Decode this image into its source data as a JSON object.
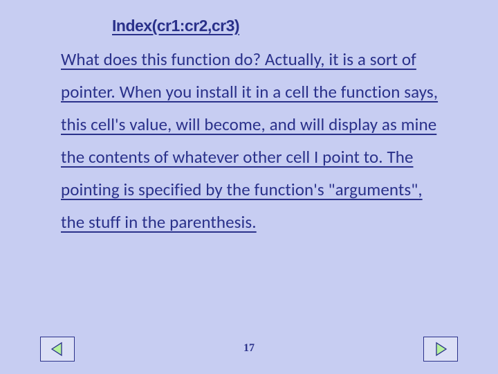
{
  "slide": {
    "title": "Index(cr1:cr2,cr3)",
    "body": "What does this function do?  Actually, it is a sort of pointer.  When you install it in a cell the function says, this cell's value, will become, and will display as mine the contents of  whatever other cell I point to.  The pointing is specified by the function's \"arguments\", the stuff in the parenthesis.",
    "page_number": "17"
  },
  "nav": {
    "prev_icon": "triangle-left",
    "next_icon": "triangle-right"
  },
  "colors": {
    "background": "#c7cdf2",
    "text": "#2a318a",
    "button_fill": "#dbdff6",
    "arrow_fill": "#b6f29c"
  }
}
